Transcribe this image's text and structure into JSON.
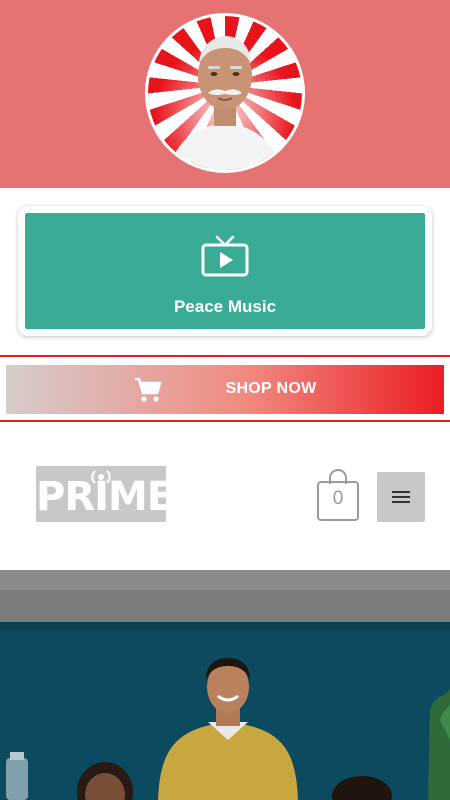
{
  "header": {
    "avatar": {
      "icon": "guru-portrait-icon"
    }
  },
  "media_card": {
    "icon": "tv-play-icon",
    "label": "Peace Music",
    "color": "#3aab95"
  },
  "shop_banner": {
    "icon": "shopping-cart-icon",
    "label": "SHOP NOW",
    "accent": "#e51d24"
  },
  "nav": {
    "logo_text": "PRIME",
    "cart_count": "0",
    "menu_icon": "hamburger-menu-icon"
  },
  "hero_photo": {
    "description_icon": "people-photo"
  }
}
